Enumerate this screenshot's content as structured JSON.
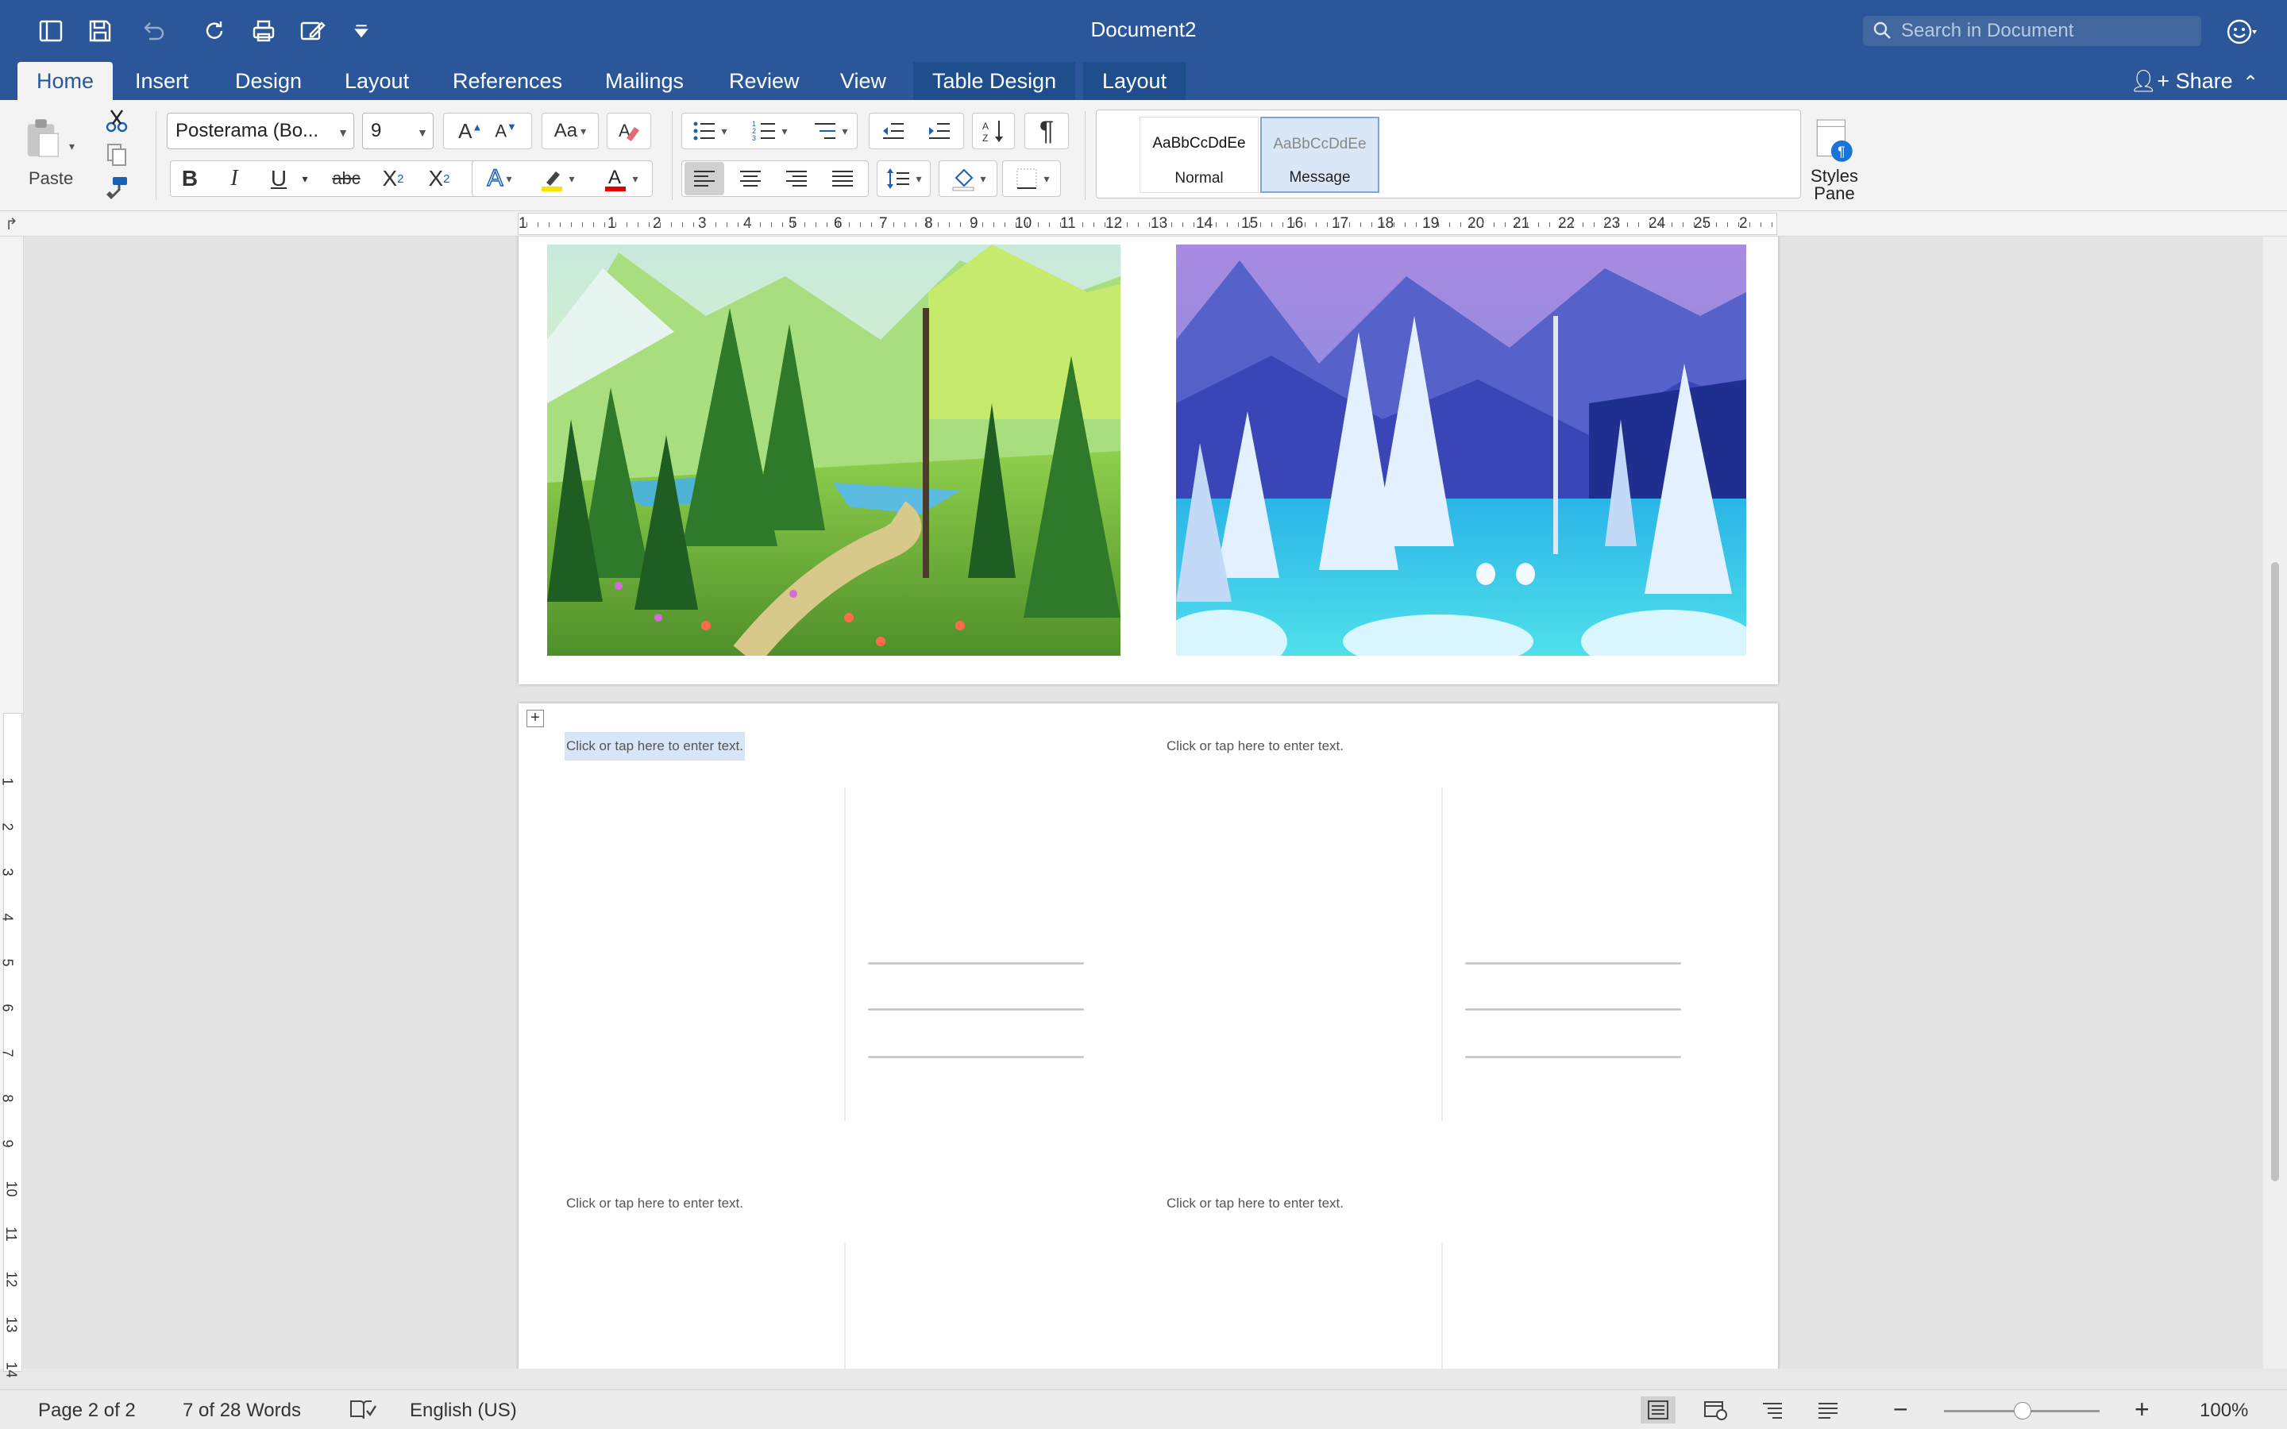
{
  "window": {
    "title": "Document2"
  },
  "search": {
    "placeholder": "Search in Document"
  },
  "tabs": [
    {
      "label": "Home"
    },
    {
      "label": "Insert"
    },
    {
      "label": "Design"
    },
    {
      "label": "Layout"
    },
    {
      "label": "References"
    },
    {
      "label": "Mailings"
    },
    {
      "label": "Review"
    },
    {
      "label": "View"
    },
    {
      "label": "Table Design"
    },
    {
      "label": "Layout"
    }
  ],
  "share_label": "Share",
  "ribbon": {
    "paste_label": "Paste",
    "font_name": "Posterama (Bo...",
    "font_size": "9",
    "bold": "B",
    "italic": "I",
    "underline": "U",
    "strike": "abc",
    "sub": "X",
    "sup": "X",
    "styles": [
      {
        "preview": "AaBbCcDdEe",
        "name": "Normal"
      },
      {
        "preview": "AaBbCcDdEe",
        "name": "Message"
      }
    ],
    "styles_pane_line1": "Styles",
    "styles_pane_line2": "Pane"
  },
  "ruler_numbers": [
    "1",
    "1",
    "2",
    "3",
    "4",
    "5",
    "6",
    "7",
    "8",
    "9",
    "10",
    "11",
    "12",
    "13",
    "14",
    "15",
    "16",
    "17",
    "18",
    "19",
    "20",
    "21",
    "22",
    "23",
    "24",
    "25",
    "2"
  ],
  "vruler_numbers": [
    "1",
    "2",
    "3",
    "4",
    "5",
    "6",
    "7",
    "8",
    "9",
    "10",
    "11",
    "12",
    "13",
    "14"
  ],
  "document": {
    "placeholder": "Click or tap here to enter text."
  },
  "status": {
    "page": "Page 2 of 2",
    "words": "7 of 28 Words",
    "language": "English (US)",
    "zoom": "100%"
  },
  "colors": {
    "brand": "#2b579a",
    "highlight": "#d6e6f8"
  }
}
